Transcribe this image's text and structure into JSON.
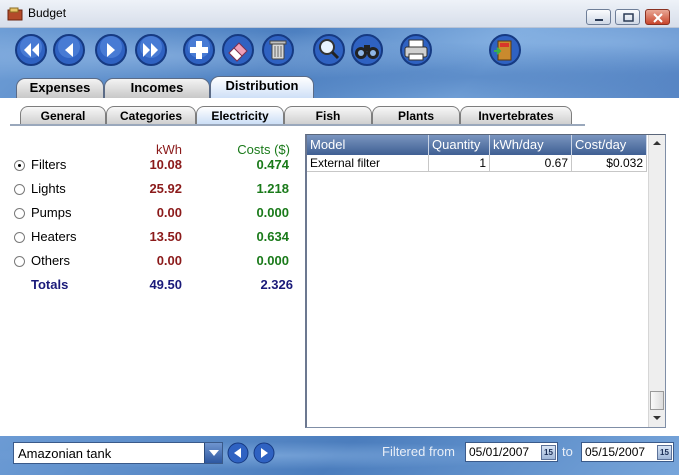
{
  "window": {
    "title": "Budget"
  },
  "toolbar": {
    "buttons": [
      "first-icon",
      "previous-icon",
      "next-icon",
      "last-icon",
      "add-icon",
      "eraser-icon",
      "trash-icon",
      "search-icon",
      "binoculars-icon",
      "printer-icon",
      "exit-icon"
    ]
  },
  "main_tabs": [
    "Expenses",
    "Incomes",
    "Distribution"
  ],
  "sub_tabs": [
    "General",
    "Categories",
    "Electricity",
    "Fish",
    "Plants",
    "Invertebrates"
  ],
  "summary": {
    "kwh_header": "kWh",
    "cost_header": "Costs ($)",
    "rows": [
      {
        "label": "Filters",
        "kwh": "10.08",
        "cost": "0.474",
        "selected": true
      },
      {
        "label": "Lights",
        "kwh": "25.92",
        "cost": "1.218",
        "selected": false
      },
      {
        "label": "Pumps",
        "kwh": "0.00",
        "cost": "0.000",
        "selected": false
      },
      {
        "label": "Heaters",
        "kwh": "13.50",
        "cost": "0.634",
        "selected": false
      },
      {
        "label": "Others",
        "kwh": "0.00",
        "cost": "0.000",
        "selected": false
      }
    ],
    "totals": {
      "label": "Totals",
      "kwh": "49.50",
      "cost": "2.326"
    }
  },
  "table": {
    "columns": [
      "Model",
      "Quantity",
      "kWh/day",
      "Cost/day"
    ],
    "rows": [
      [
        "External filter",
        "1",
        "0.67",
        "$0.032"
      ]
    ]
  },
  "footer": {
    "tank": "Amazonian tank",
    "filtered_from_label": "Filtered from",
    "from_date": "05/01/2007",
    "to_label": "to",
    "to_date": "05/15/2007",
    "calendar_label": "15"
  },
  "colors": {
    "kwh": "#8b1a1a",
    "cost": "#1a7a1a",
    "totals": "#1a1a7a",
    "header_blue": "#3f5f93"
  }
}
